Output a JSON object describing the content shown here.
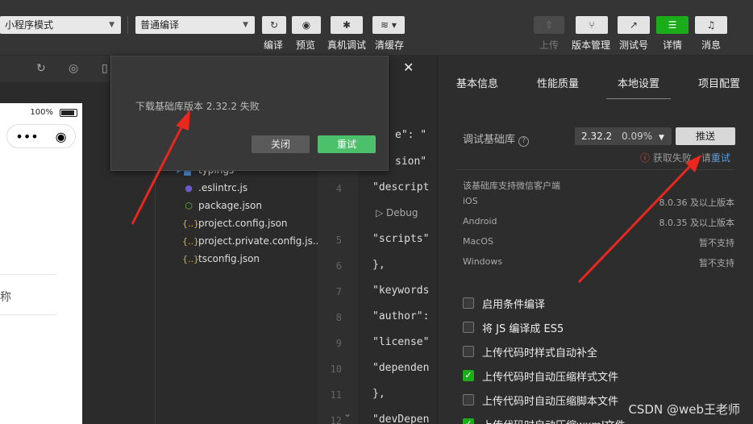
{
  "toolbar": {
    "mode_select": "小程序模式",
    "compile_select": "普通编译",
    "buttons": {
      "compile": "编译",
      "preview": "预览",
      "device_debug": "真机调试",
      "clear_cache": "清缓存",
      "upload": "上传",
      "version": "版本管理",
      "test_account": "测试号",
      "details": "详情",
      "messages": "消息"
    }
  },
  "simulator": {
    "battery_pct": "100%",
    "capsule_dots": "•••",
    "capsule_target": "◉",
    "partial_text": "称"
  },
  "tree": {
    "items": [
      {
        "name": "typings",
        "icon": "folder-icon"
      },
      {
        "name": ".eslintrc.js",
        "icon": "eslint-icon"
      },
      {
        "name": "package.json",
        "icon": "node-icon"
      },
      {
        "name": "project.config.json",
        "icon": "json-icon"
      },
      {
        "name": "project.private.config.js...",
        "icon": "json-icon"
      },
      {
        "name": "tsconfig.json",
        "icon": "json-icon"
      }
    ]
  },
  "editor": {
    "lines": [
      {
        "num": "",
        "code": "e\": \""
      },
      {
        "num": "",
        "code": "sion\""
      },
      {
        "num": "4",
        "code": "\"descript"
      },
      {
        "num": "5",
        "code": "\"scripts\""
      },
      {
        "num": "6",
        "code": "},"
      },
      {
        "num": "7",
        "code": "\"keywords"
      },
      {
        "num": "8",
        "code": "\"author\":"
      },
      {
        "num": "9",
        "code": "\"license\""
      },
      {
        "num": "10",
        "code": "\"dependen"
      },
      {
        "num": "11",
        "code": "},"
      },
      {
        "num": "12",
        "code": "\"devDepen"
      }
    ],
    "debug_label": "▷ Debug"
  },
  "popup": {
    "message": "下载基础库版本 2.32.2 失败",
    "close": "关闭",
    "retry": "重试"
  },
  "panel": {
    "tabs": [
      "基本信息",
      "性能质量",
      "本地设置",
      "项目配置"
    ],
    "active_tab": "本地设置",
    "debug_lib_label": "调试基础库",
    "version": "2.32.2",
    "version_pct": "0.09%",
    "push": "推送",
    "fail_text": "获取失败，请",
    "fail_retry": "重试",
    "support_title": "该基础库支持微信客户端",
    "support_rows": [
      {
        "os": "iOS",
        "value": "8.0.36 及以上版本"
      },
      {
        "os": "Android",
        "value": "8.0.35 及以上版本"
      },
      {
        "os": "MacOS",
        "value": "暂不支持"
      },
      {
        "os": "Windows",
        "value": "暂不支持"
      }
    ],
    "options": [
      {
        "label": "启用条件编译",
        "checked": false
      },
      {
        "label": "将 JS 编译成 ES5",
        "checked": false
      },
      {
        "label": "上传代码时样式自动补全",
        "checked": false
      },
      {
        "label": "上传代码时自动压缩样式文件",
        "checked": true
      },
      {
        "label": "上传代码时自动压缩脚本文件",
        "checked": false
      },
      {
        "label": "上传代码时自动压缩wxml文件",
        "checked": true
      }
    ]
  },
  "watermark": "CSDN @web王老师",
  "colors": {
    "accent_green": "#1aad19",
    "arrow_red": "#e8271f",
    "link_blue": "#5b9bd5"
  }
}
